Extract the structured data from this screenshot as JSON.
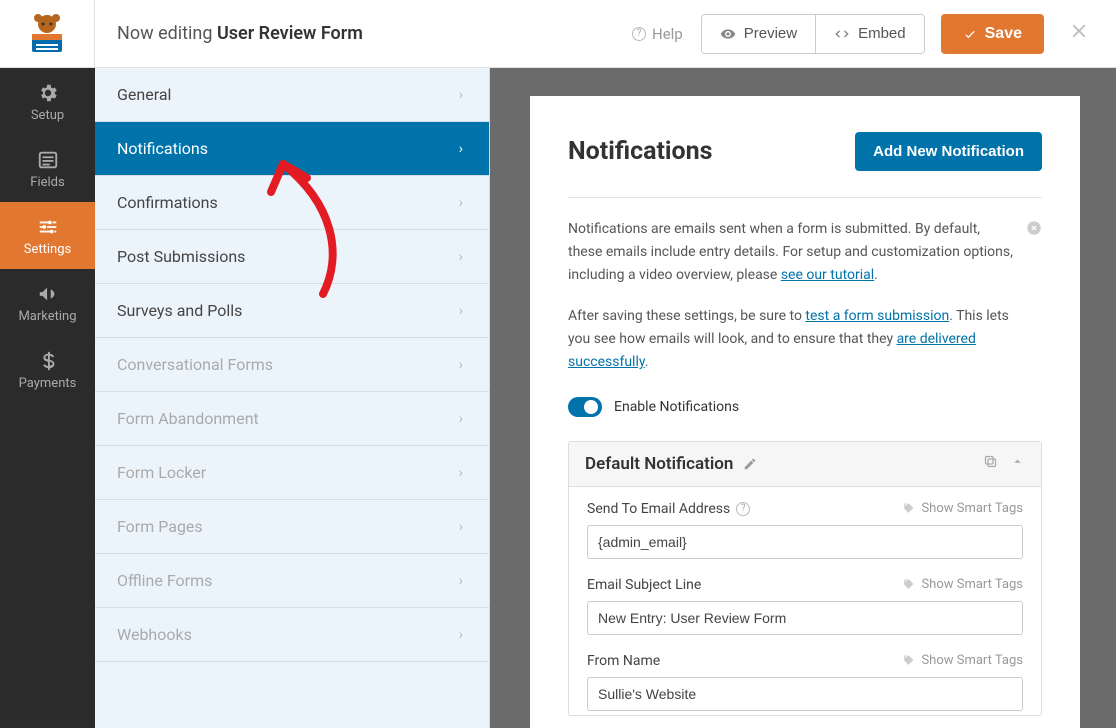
{
  "header": {
    "editing_prefix": "Now editing ",
    "form_name": "User Review Form",
    "help": "Help",
    "preview": "Preview",
    "embed": "Embed",
    "save": "Save"
  },
  "nav": {
    "setup": "Setup",
    "fields": "Fields",
    "settings": "Settings",
    "marketing": "Marketing",
    "payments": "Payments"
  },
  "settings_list": {
    "general": "General",
    "notifications": "Notifications",
    "confirmations": "Confirmations",
    "post_submissions": "Post Submissions",
    "surveys_polls": "Surveys and Polls",
    "conversational": "Conversational Forms",
    "abandonment": "Form Abandonment",
    "locker": "Form Locker",
    "pages": "Form Pages",
    "offline": "Offline Forms",
    "webhooks": "Webhooks"
  },
  "panel": {
    "title": "Notifications",
    "add_button": "Add New Notification",
    "desc1_a": "Notifications are emails sent when a form is submitted. By default, these emails include entry details. For setup and customization options, including a video overview, please ",
    "desc1_link": "see our tutorial",
    "desc2_a": "After saving these settings, be sure to ",
    "desc2_link1": "test a form submission",
    "desc2_b": ". This lets you see how emails will look, and to ensure that they ",
    "desc2_link2": "are delivered successfully",
    "toggle_label": "Enable Notifications",
    "default_title": "Default Notification",
    "smart_tags": "Show Smart Tags",
    "fields": {
      "send_to": {
        "label": "Send To Email Address",
        "value": "{admin_email}"
      },
      "subject": {
        "label": "Email Subject Line",
        "value": "New Entry: User Review Form"
      },
      "from_name": {
        "label": "From Name",
        "value": "Sullie's Website"
      }
    }
  }
}
